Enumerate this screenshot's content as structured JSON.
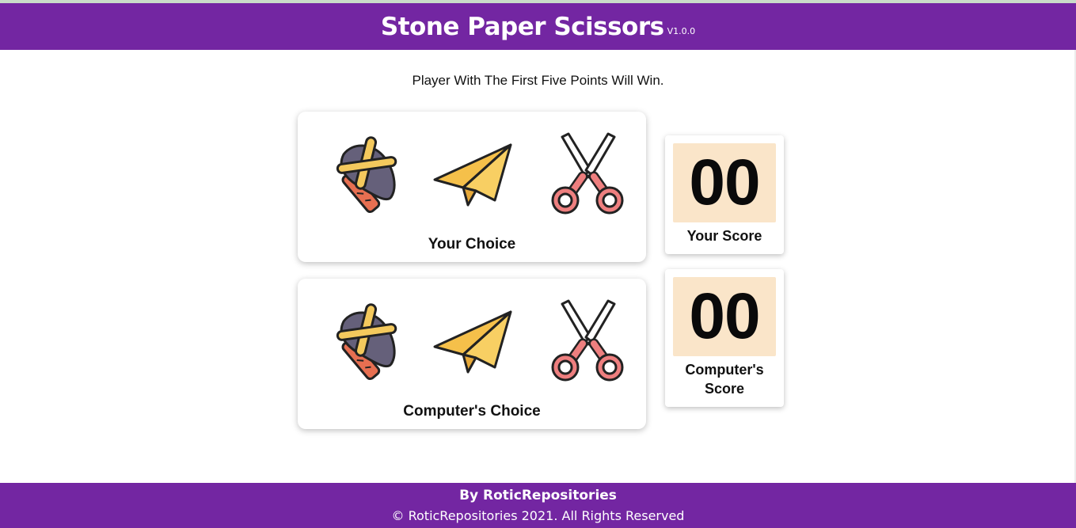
{
  "header": {
    "title": "Stone Paper Scissors",
    "version": "V1.0.0",
    "color": "#7326a2"
  },
  "subtitle": "Player With The First Five Points Will Win.",
  "player_panel": {
    "label": "Your Choice",
    "options": [
      "stone-icon",
      "paper-plane-icon",
      "scissors-icon"
    ]
  },
  "computer_panel": {
    "label": "Computer's Choice",
    "options": [
      "stone-icon",
      "paper-plane-icon",
      "scissors-icon"
    ]
  },
  "scores": {
    "player": {
      "value": "00",
      "label": "Your Score"
    },
    "computer": {
      "value": "00",
      "label": "Computer's Score"
    },
    "box_color": "#fae5c9"
  },
  "footer": {
    "by": "By RoticRepositories",
    "copyright": "© RoticRepositories 2021. All Rights Reserved"
  }
}
